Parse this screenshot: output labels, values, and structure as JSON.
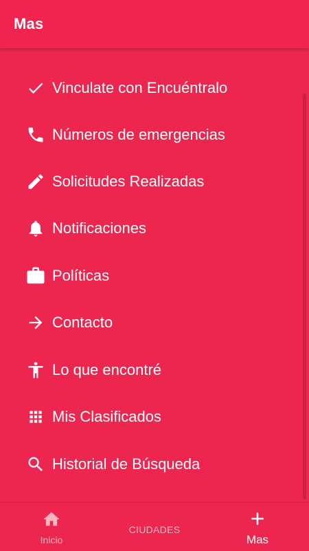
{
  "appbar": {
    "title": "Mas"
  },
  "menu": {
    "items": [
      {
        "label": "Vinculate con Encuéntralo",
        "icon": "check-icon"
      },
      {
        "label": "Números de emergencias",
        "icon": "phone-icon"
      },
      {
        "label": "Solicitudes Realizadas",
        "icon": "pencil-icon"
      },
      {
        "label": "Notificaciones",
        "icon": "bell-icon"
      },
      {
        "label": "Políticas",
        "icon": "briefcase-icon"
      },
      {
        "label": "Contacto",
        "icon": "arrow-right-icon"
      },
      {
        "label": "Lo que encontré",
        "icon": "accessibility-person-icon"
      },
      {
        "label": "Mis Clasificados",
        "icon": "grid-apps-icon"
      },
      {
        "label": "Historial de Búsqueda",
        "icon": "search-icon"
      }
    ]
  },
  "bottom_nav": {
    "inicio": "Inicio",
    "ciudades": "CIUDADES",
    "mas": "Mas"
  },
  "colors": {
    "background": "#ED2650",
    "scrollbar": "#C9233F",
    "inactive_nav": "#F9B4C2"
  }
}
